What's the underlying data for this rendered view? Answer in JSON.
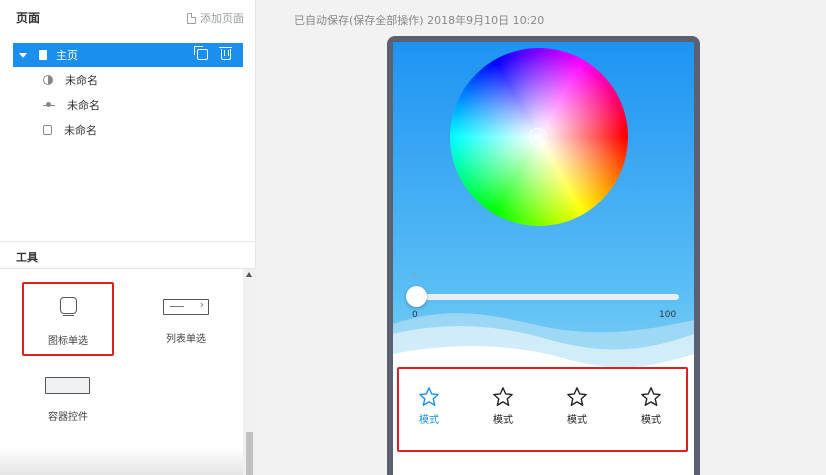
{
  "pages_panel": {
    "title": "页面",
    "add_page_label": "添加页面",
    "tree": {
      "main": {
        "label": "主页",
        "icon": "page-icon"
      },
      "children": [
        {
          "label": "未命名",
          "icon": "half-circle-icon"
        },
        {
          "label": "未命名",
          "icon": "slider-icon"
        },
        {
          "label": "未命名",
          "icon": "box-icon"
        }
      ]
    }
  },
  "tools_panel": {
    "title": "工具",
    "items": [
      {
        "label": "图标单选",
        "selected": true
      },
      {
        "label": "列表单选",
        "selected": false
      },
      {
        "label": "容器控件",
        "selected": false
      }
    ]
  },
  "autosave_text": "已自动保存(保存全部操作) 2018年9月10日 10:20",
  "phone": {
    "slider": {
      "value": "0",
      "min": "0",
      "max": "100",
      "current": 0
    },
    "modes": [
      {
        "label": "模式",
        "active": true
      },
      {
        "label": "模式",
        "active": false
      },
      {
        "label": "模式",
        "active": false
      },
      {
        "label": "模式",
        "active": false
      }
    ]
  },
  "colors": {
    "accent": "#1a8ff0",
    "highlight_red": "#e02020",
    "phone_frame": "#5b6170"
  }
}
